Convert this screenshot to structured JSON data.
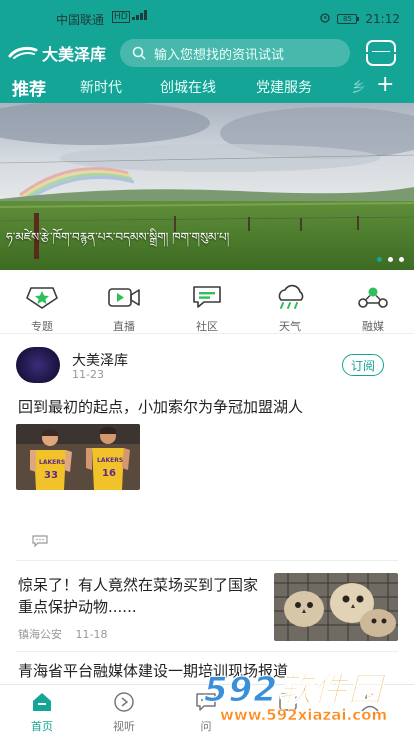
{
  "statusbar": {
    "carrier": "中国联通",
    "network": "HD",
    "battery": "85",
    "time": "21:12"
  },
  "header": {
    "logo_text": "大美泽库",
    "search_placeholder": "输入您想找的资讯试试",
    "brand_color": "#15a596"
  },
  "tabs": [
    {
      "label": "推荐",
      "active": true
    },
    {
      "label": "新时代",
      "active": false
    },
    {
      "label": "创城在线",
      "active": false
    },
    {
      "label": "党建服务",
      "active": false
    },
    {
      "label": "乡",
      "active": false
    }
  ],
  "banner": {
    "caption": "ཧ་མཛེས་རྩེ་ཁོག་བརྙན་པར་བདམས་སྒྲིག། ཁག་གསུམ་པ།",
    "slide_count": 3,
    "active_slide": 1
  },
  "quicknav": [
    {
      "label": "专题",
      "icon": "star-badge-icon"
    },
    {
      "label": "直播",
      "icon": "live-camera-icon"
    },
    {
      "label": "社区",
      "icon": "community-chat-icon"
    },
    {
      "label": "天气",
      "icon": "weather-cloud-icon"
    },
    {
      "label": "融媒",
      "icon": "media-network-icon"
    }
  ],
  "post": {
    "author": "大美泽库",
    "date": "11-23",
    "subscribe_label": "订阅",
    "headline": "回到最初的起点，小加索尔为争冠加盟湖人"
  },
  "news": [
    {
      "title": "惊呆了！有人竟然在菜场买到了国家重点保护动物......",
      "source": "镇海公安",
      "date": "11-18"
    },
    {
      "title": "青海省平台融媒体建设一期培训现场报道"
    }
  ],
  "bottom_tabs": [
    {
      "label": "首页",
      "icon": "home-icon",
      "active": true
    },
    {
      "label": "视听",
      "icon": "play-circle-icon",
      "active": false
    },
    {
      "label": "问",
      "icon": "question-chat-icon",
      "active": false
    }
  ],
  "watermark": {
    "brand_digits": "592",
    "brand_text": "软件园",
    "url": "www.592xiazai.com"
  }
}
